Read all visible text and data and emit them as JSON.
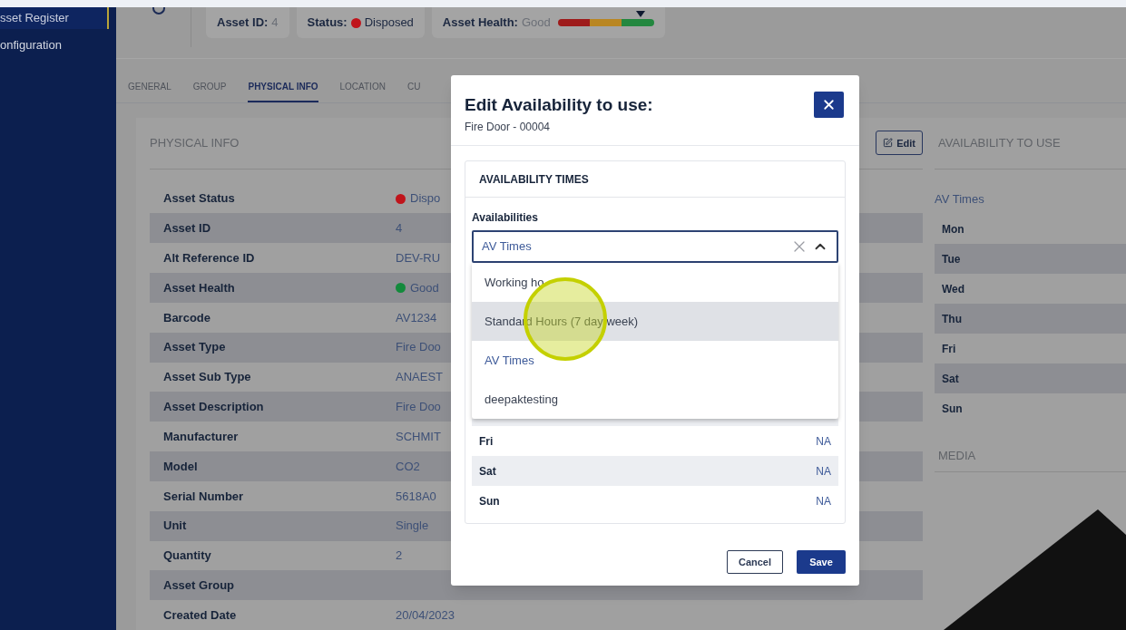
{
  "sidebar": {
    "items": [
      {
        "label": "sset Register",
        "selected": true
      },
      {
        "label": "onfiguration",
        "selected": false
      }
    ]
  },
  "header": {
    "chips": [
      {
        "kind": "text",
        "label": "Asset ID:",
        "value": "4"
      },
      {
        "kind": "status",
        "label": "Status:",
        "value": "Disposed",
        "color": "#c0141b"
      },
      {
        "kind": "health",
        "label": "Asset Health:",
        "value": "Good",
        "level": 0.86
      }
    ]
  },
  "tabs": [
    {
      "label": "GENERAL",
      "selected": false
    },
    {
      "label": "GROUP",
      "selected": false
    },
    {
      "label": "PHYSICAL INFO",
      "selected": true
    },
    {
      "label": "LOCATION",
      "selected": false
    },
    {
      "label": "CU",
      "selected": false
    }
  ],
  "physical_info": {
    "title": "PHYSICAL INFO",
    "edit_button": "Edit",
    "rows": [
      {
        "label": "Asset Status",
        "value": "Dispo",
        "color": "#c0141b"
      },
      {
        "label": "Asset ID",
        "value": "4"
      },
      {
        "label": "Alt Reference ID",
        "value": "DEV-RU"
      },
      {
        "label": "Asset Health",
        "value": "Good",
        "color": "#138a3c"
      },
      {
        "label": "Barcode",
        "value": "AV1234"
      },
      {
        "label": "Asset Type",
        "value": "Fire Doo"
      },
      {
        "label": "Asset Sub Type",
        "value": "ANAEST"
      },
      {
        "label": "Asset Description",
        "value": "Fire Doo"
      },
      {
        "label": "Manufacturer",
        "value": "SCHMIT"
      },
      {
        "label": "Model",
        "value": "CO2"
      },
      {
        "label": "Serial Number",
        "value": "5618A0"
      },
      {
        "label": "Unit",
        "value": "Single"
      },
      {
        "label": "Quantity",
        "value": "2"
      },
      {
        "label": "Asset Group"
      },
      {
        "label": "Created Date",
        "value": "20/04/2023"
      }
    ]
  },
  "availability_to_use": {
    "title": "AVAILABILITY TO USE",
    "schedule": "AV Times",
    "days": [
      "Mon",
      "Tue",
      "Wed",
      "Thu",
      "Fri",
      "Sat",
      "Sun"
    ]
  },
  "media": {
    "title": "MEDIA"
  },
  "modal": {
    "title": "Edit Availability to use:",
    "subtitle": "Fire Door - 00004",
    "section_title": "AVAILABILITY TIMES",
    "field_label": "Availabilities",
    "select": {
      "value": "AV Times",
      "options": [
        {
          "label": "Working ho",
          "selected": false,
          "hovered": false
        },
        {
          "label": "Standard Hours (7 day week)",
          "selected": false,
          "hovered": true
        },
        {
          "label": "AV Times",
          "selected": true,
          "hovered": false
        },
        {
          "label": "deepaktesting",
          "selected": false,
          "hovered": false
        }
      ]
    },
    "days": [
      {
        "day": "Fri",
        "value": "NA"
      },
      {
        "day": "Sat",
        "value": "NA"
      },
      {
        "day": "Sun",
        "value": "NA"
      }
    ],
    "buttons": {
      "cancel": "Cancel",
      "save": "Save"
    }
  }
}
